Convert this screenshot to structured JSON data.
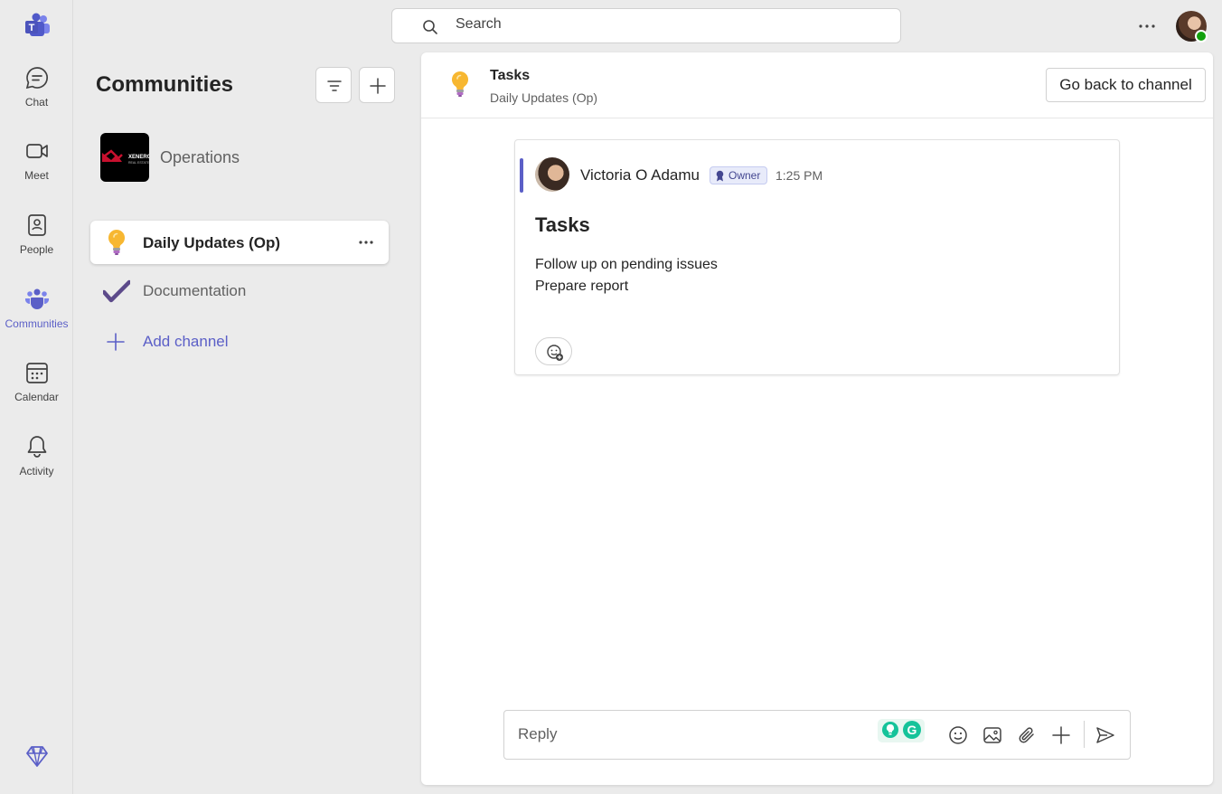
{
  "rail": {
    "items": [
      {
        "label": "Chat",
        "icon": "chat-icon"
      },
      {
        "label": "Meet",
        "icon": "video-icon"
      },
      {
        "label": "People",
        "icon": "people-icon"
      },
      {
        "label": "Communities",
        "icon": "communities-icon",
        "active": true
      },
      {
        "label": "Calendar",
        "icon": "calendar-icon"
      },
      {
        "label": "Activity",
        "icon": "bell-icon"
      }
    ]
  },
  "search": {
    "placeholder": "Search"
  },
  "sidebar": {
    "title": "Communities",
    "community": {
      "name": "Operations",
      "logo_text": "XENERGY"
    },
    "channels": [
      {
        "name": "Daily Updates (Op)",
        "icon": "lightbulb-icon",
        "active": true
      },
      {
        "name": "Documentation",
        "icon": "checkmark-icon",
        "active": false
      }
    ],
    "add_channel_label": "Add channel"
  },
  "header": {
    "title": "Tasks",
    "subtitle": "Daily Updates (Op)",
    "back_button": "Go back to channel"
  },
  "post": {
    "author": "Victoria O Adamu",
    "badge": "Owner",
    "time": "1:25 PM",
    "subject": "Tasks",
    "lines": [
      "Follow up on pending issues",
      "Prepare report"
    ]
  },
  "reply": {
    "placeholder": "Reply"
  },
  "colors": {
    "accent": "#5b5fc7",
    "status_available": "#13a10e",
    "bulb": "#f7b731"
  }
}
